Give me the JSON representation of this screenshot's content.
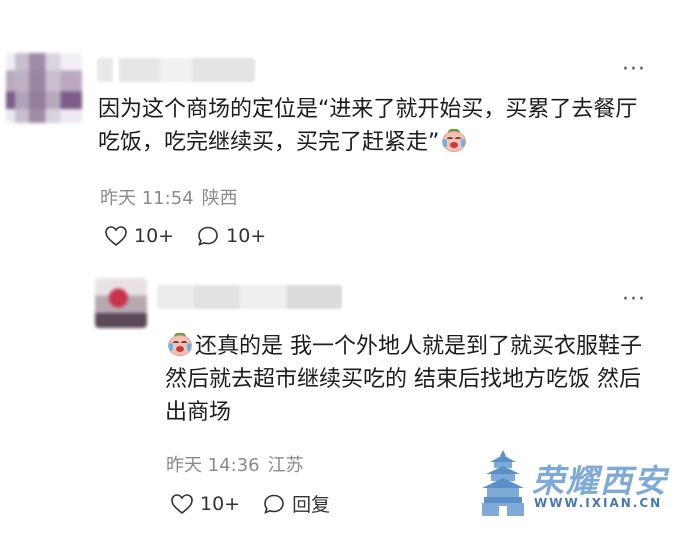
{
  "comment": {
    "text_before_emoji": "因为这个商场的定位是“进来了就开始买，买累了去餐厅吃饭，吃完继续买，买完了赶紧走”",
    "emoji": "crying-face-emoji",
    "time": "昨天 11:54",
    "location": "陕西",
    "like_count": "10+",
    "reply_count": "10+"
  },
  "reply": {
    "emoji": "crying-face-emoji",
    "text_after_emoji": "还真的是 我一个外地人就是到了就买衣服鞋子 然后就去超市继续买吃的 结束后找地方吃饭 然后出商场",
    "time": "昨天 14:36",
    "location": "江苏",
    "like_count": "10+",
    "reply_label": "回复"
  },
  "more_label": "···",
  "watermark": {
    "title": "荣耀西安",
    "url": "WWW.IXIAN.CN",
    "icon": "bell-tower-logo-icon"
  },
  "colors": {
    "text": "#1c1c1c",
    "meta": "#8a8a8a",
    "watermark": "#4a78ad"
  }
}
